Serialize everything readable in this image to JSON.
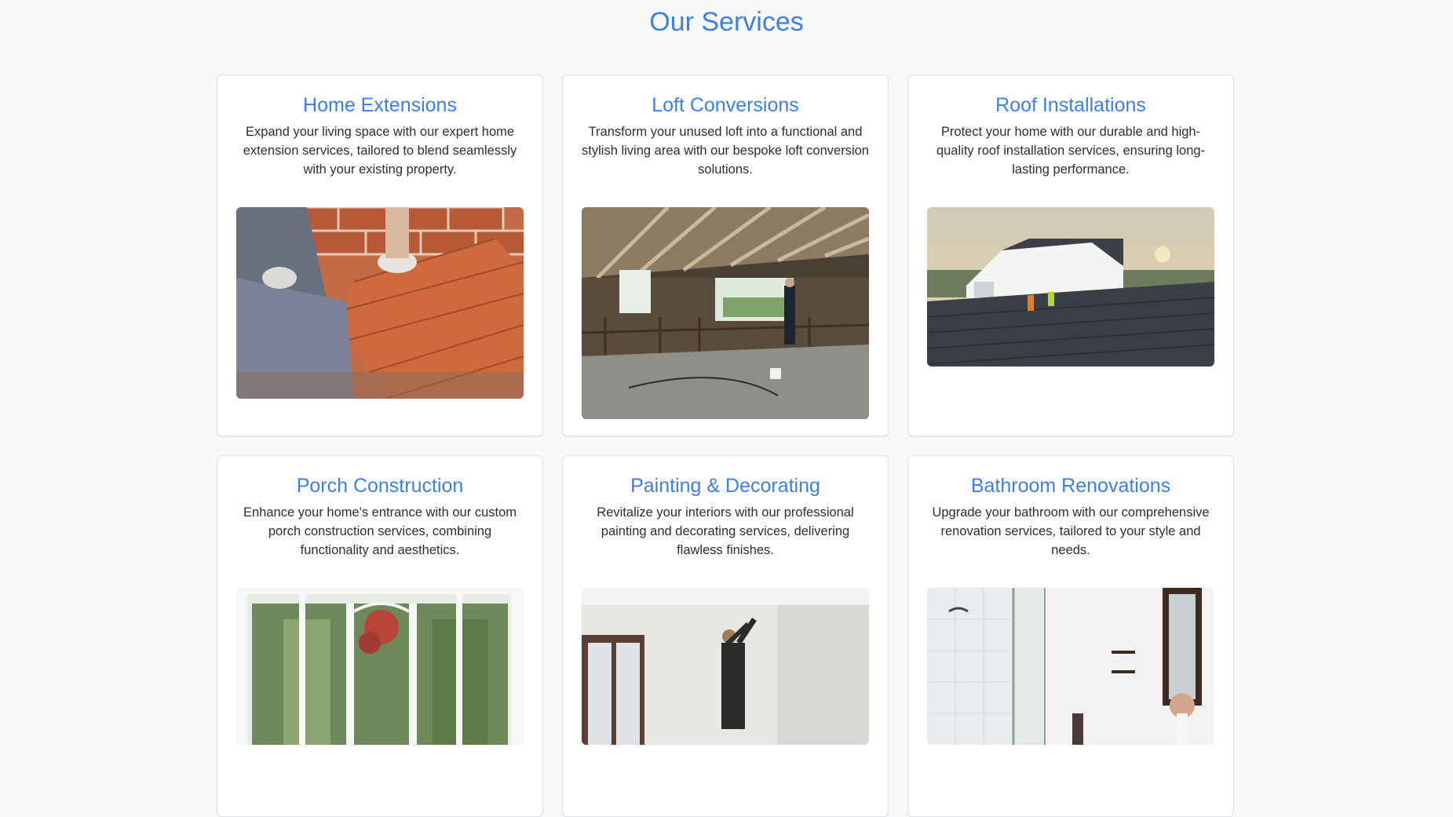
{
  "page": {
    "title": "Our Services"
  },
  "services": [
    {
      "title": "Home Extensions",
      "description": "Expand your living space with our expert home extension services, tailored to blend seamlessly with your existing property.",
      "image": "bricklaying-photo"
    },
    {
      "title": "Loft Conversions",
      "description": "Transform your unused loft into a functional and stylish living area with our bespoke loft conversion solutions.",
      "image": "loft-interior-photo"
    },
    {
      "title": "Roof Installations",
      "description": "Protect your home with our durable and high-quality roof installation services, ensuring long-lasting performance.",
      "image": "roof-workers-photo"
    },
    {
      "title": "Porch Construction",
      "description": "Enhance your home's entrance with our custom porch construction services, combining functionality and aesthetics.",
      "image": "glass-porch-photo"
    },
    {
      "title": "Painting & Decorating",
      "description": "Revitalize your interiors with our professional painting and decorating services, delivering flawless finishes.",
      "image": "painter-photo"
    },
    {
      "title": "Bathroom Renovations",
      "description": "Upgrade your bathroom with our comprehensive renovation services, tailored to your style and needs.",
      "image": "bathroom-photo"
    }
  ],
  "colors": {
    "accent": "#3c7fe6",
    "background": "#f8f9fa",
    "card": "#ffffff",
    "border": "#dee2e6"
  }
}
